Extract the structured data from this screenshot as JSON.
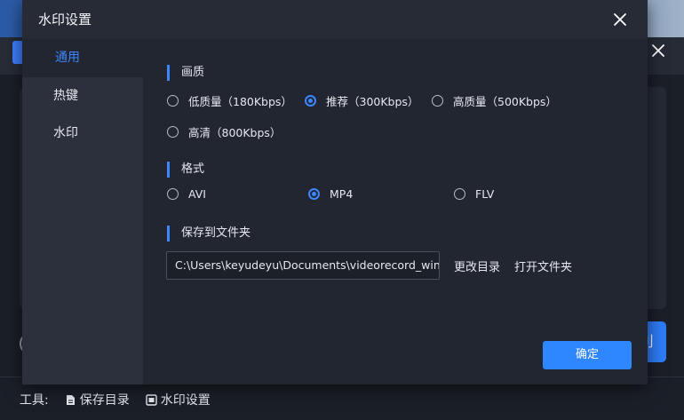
{
  "app": {
    "toolbar": {
      "label": "工具:",
      "save_dir": "保存目录",
      "watermark_settings": "水印设置"
    },
    "accent_button_glyph": "刂"
  },
  "dialog": {
    "title": "水印设置",
    "nav": [
      {
        "label": "通用",
        "active": true
      },
      {
        "label": "热键",
        "active": false
      },
      {
        "label": "水印",
        "active": false
      }
    ],
    "quality": {
      "title": "画质",
      "options": [
        {
          "label": "低质量（180Kbps）",
          "checked": false
        },
        {
          "label": "推荐（300Kbps）",
          "checked": true
        },
        {
          "label": "高质量（500Kbps）",
          "checked": false
        },
        {
          "label": "高清（800Kbps）",
          "checked": false
        }
      ]
    },
    "format": {
      "title": "格式",
      "options": [
        {
          "label": "AVI",
          "checked": false
        },
        {
          "label": "MP4",
          "checked": true
        },
        {
          "label": "FLV",
          "checked": false
        }
      ]
    },
    "folder": {
      "title": "保存到文件夹",
      "path": "C:\\Users\\keyudeyu\\Documents\\videorecord_win",
      "change_dir": "更改目录",
      "open_folder": "打开文件夹"
    },
    "confirm": "确定"
  },
  "colors": {
    "accent": "#3d86ff",
    "button": "#2e87ff",
    "dialog_bg": "#222630",
    "nav_bg": "#2b303c"
  }
}
